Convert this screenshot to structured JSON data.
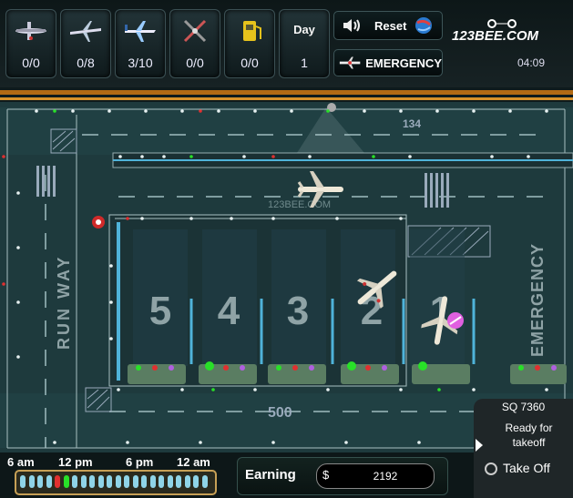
{
  "stats": [
    {
      "icon": "taxiing-plane-icon",
      "value": "0/0"
    },
    {
      "icon": "jet-plane-icon",
      "value": "0/8"
    },
    {
      "icon": "airliner-icon",
      "value": "3/10"
    },
    {
      "icon": "repair-tools-icon",
      "value": "0/0"
    },
    {
      "icon": "fuel-pump-icon",
      "value": "0/0"
    }
  ],
  "day": {
    "label": "Day",
    "value": "1"
  },
  "controls": {
    "reset_label": "Reset",
    "emergency_label": "EMERGENCY"
  },
  "logo": "123BEE.COM",
  "clock": "04:09",
  "field": {
    "runway_label": "RUN WAY",
    "emergency_label": "EMERGENCY",
    "taxi_numbers": [
      "134",
      "500"
    ],
    "gates": [
      "5",
      "4",
      "3",
      "2",
      "1"
    ],
    "watermark": "123BEE.COM"
  },
  "timeline": {
    "labels": [
      "6 am",
      "12 pm",
      "6 pm",
      "12 am"
    ],
    "segments": 22
  },
  "earning": {
    "label": "Earning",
    "currency": "$",
    "value": "2192"
  },
  "flight_panel": {
    "code": "SQ 7360",
    "status": "Ready for takeoff",
    "takeoff_label": "Take Off"
  },
  "colors": {
    "accent_orange": "#d8922a",
    "field_green": "#1f3b3e",
    "rail_blue": "#4fb3d9",
    "gate_light_green": "#28e028",
    "gate_light_red": "#e03030",
    "gate_light_purple": "#b060e0",
    "alert_pink": "#e060e0"
  }
}
